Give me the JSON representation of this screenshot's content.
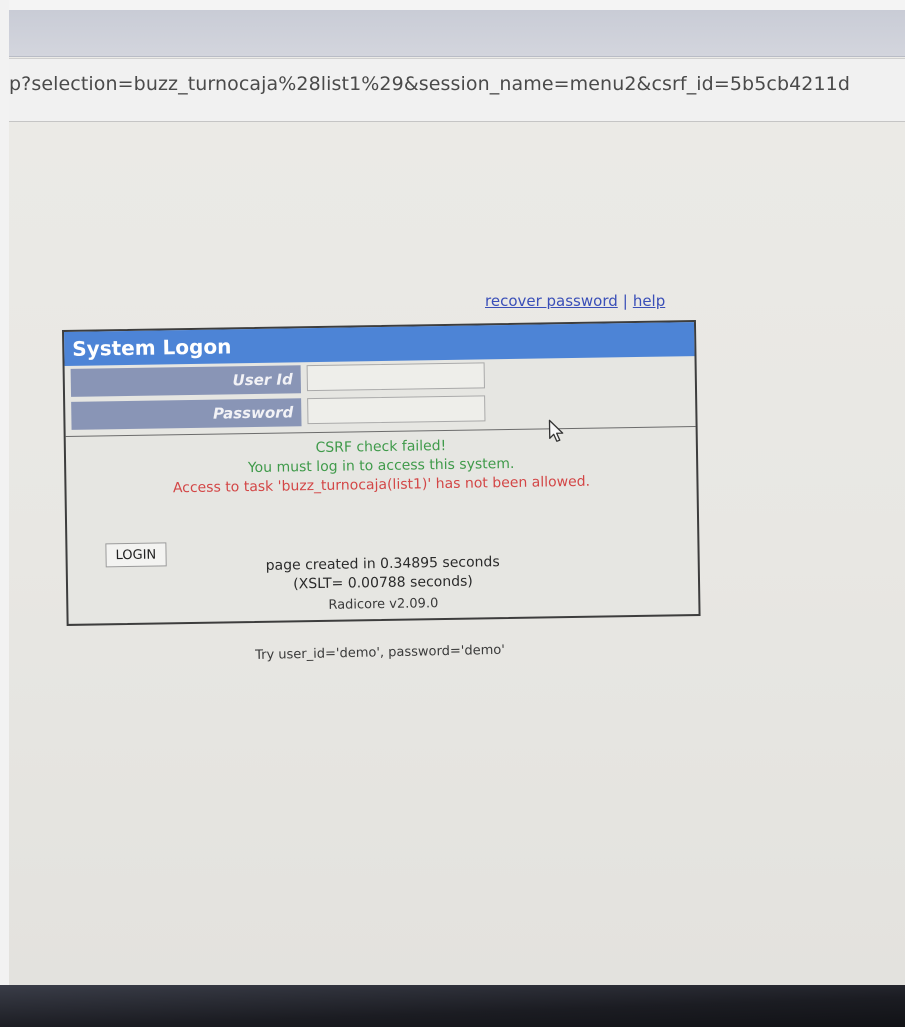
{
  "address_bar": {
    "url_fragment": "p?selection=buzz_turnocaja%28list1%29&session_name=menu2&csrf_id=5b5cb4211d"
  },
  "links": {
    "recover_password": "recover password",
    "separator": "|",
    "help": "help"
  },
  "logon": {
    "title": "System Logon",
    "user_id_label": "User Id",
    "password_label": "Password",
    "user_id_value": "",
    "password_value": "",
    "login_button": "LOGIN"
  },
  "messages": {
    "csrf": "CSRF check failed!",
    "must_login": "You must log in to access this system.",
    "access_denied": "Access to task 'buzz_turnocaja(list1)' has not been allowed."
  },
  "stats": {
    "page_created": "page created in 0.34895 seconds",
    "xslt": "(XSLT= 0.00788 seconds)",
    "version": "Radicore v2.09.0"
  },
  "hint": "Try user_id='demo', password='demo'",
  "colors": {
    "header_blue": "#4d84d6",
    "label_bg": "#8995b6",
    "message_green": "#3f9a4a",
    "message_red": "#d34646",
    "link_blue": "#3a4fb8"
  },
  "icons": {
    "cursor": "mouse-pointer-icon"
  }
}
